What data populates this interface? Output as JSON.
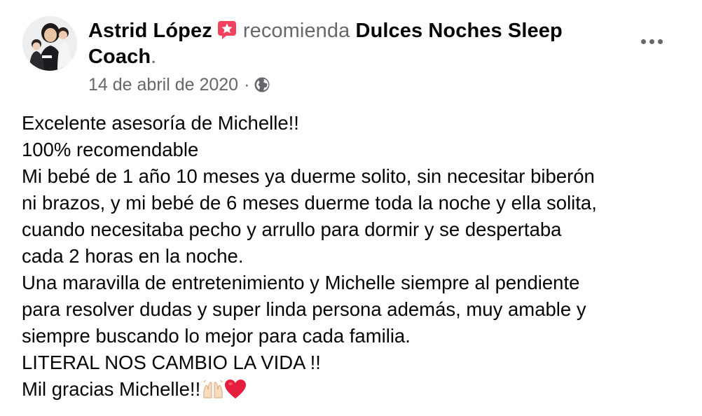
{
  "post": {
    "author": "Astrid López",
    "author_badge_icon": "star-badge-icon",
    "verb": "recomienda",
    "page_name_line1": "Dulces Noches Sleep",
    "page_name_line2": "Coach",
    "period": ".",
    "date": "14 de abril de 2020",
    "separator": "·",
    "privacy_icon": "globe-icon",
    "more_icon": "more-options-icon",
    "body_lines": [
      "Excelente asesoría de Michelle!!",
      "100% recomendable",
      "Mi bebé de 1 año 10 meses ya duerme solito, sin necesitar biberón",
      "ni brazos, y mi bebé de 6 meses duerme toda la noche y ella solita,",
      "cuando necesitaba pecho y arrullo para dormir y se despertaba",
      "cada 2 horas en la noche.",
      "Una maravilla de entretenimiento y Michelle siempre al pendiente",
      "para resolver dudas y super linda persona además, muy amable y",
      "siempre buscando lo mejor para cada familia.",
      "LITERAL NOS CAMBIO LA VIDA !!",
      "Mil gracias Michelle!!"
    ],
    "closing_emojis": [
      "raising-hands-icon",
      "red-heart-icon"
    ]
  },
  "colors": {
    "primary_text": "#050505",
    "secondary_text": "#65676b",
    "badge_pink": "#f3425f",
    "heart_red": "#e41e3f"
  }
}
